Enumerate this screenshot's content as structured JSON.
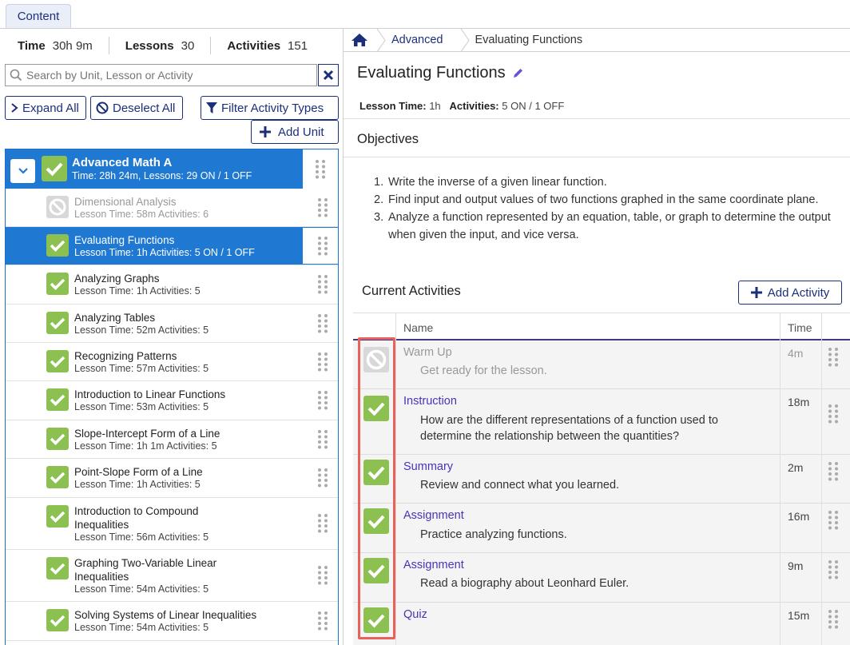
{
  "top_tab": {
    "label": "Content"
  },
  "stats": [
    {
      "key": "Time",
      "value": "30h 9m"
    },
    {
      "key": "Lessons",
      "value": "30"
    },
    {
      "key": "Activities",
      "value": "151"
    }
  ],
  "search": {
    "placeholder": "Search by Unit, Lesson or Activity"
  },
  "buttons": {
    "expand_all": "Expand All",
    "deselect_all": "Deselect All",
    "filter_activity_types": "Filter Activity Types",
    "add_unit": "Add Unit"
  },
  "unit": {
    "title": "Advanced Math A",
    "subtitle": "Time: 28h 24m, Lessons: 29 ON / 1 OFF"
  },
  "lessons": [
    {
      "title": "Dimensional Analysis",
      "sub": "Lesson Time: 58m   Activities: 6",
      "state": "off"
    },
    {
      "title": "Evaluating Functions",
      "sub": "Lesson Time: 1h   Activities: 5 ON / 1 OFF",
      "state": "selected"
    },
    {
      "title": "Analyzing Graphs",
      "sub": "Lesson Time: 1h   Activities: 5",
      "state": "on"
    },
    {
      "title": "Analyzing Tables",
      "sub": "Lesson Time: 52m   Activities: 5",
      "state": "on"
    },
    {
      "title": "Recognizing Patterns",
      "sub": "Lesson Time: 57m   Activities: 5",
      "state": "on"
    },
    {
      "title": "Introduction to Linear Functions",
      "sub": "Lesson Time: 53m   Activities: 5",
      "state": "on"
    },
    {
      "title": "Slope-Intercept Form of a Line",
      "sub": "Lesson Time: 1h 1m   Activities: 5",
      "state": "on"
    },
    {
      "title": "Point-Slope Form of a Line",
      "sub": "Lesson Time: 1h   Activities: 5",
      "state": "on"
    },
    {
      "title": "Introduction to Compound Inequalities",
      "sub": "Lesson Time: 56m   Activities: 5",
      "state": "on"
    },
    {
      "title": "Graphing Two-Variable Linear Inequalities",
      "sub": "Lesson Time: 54m   Activities: 5",
      "state": "on"
    },
    {
      "title": "Solving Systems of Linear Inequalities",
      "sub": "Lesson Time: 54m   Activities: 5",
      "state": "on"
    }
  ],
  "breadcrumb": {
    "items": [
      "Advanced",
      "Evaluating Functions"
    ]
  },
  "detail": {
    "title": "Evaluating Functions",
    "meta_time_label": "Lesson Time:",
    "meta_time_value": "1h",
    "meta_act_label": "Activities:",
    "meta_act_value": "5 ON / 1 OFF",
    "objectives_title": "Objectives",
    "objectives": [
      "Write the inverse of a given linear function.",
      "Find input and output values of two functions graphed in the same coordinate plane.",
      "Analyze a function represented by an equation, table, or graph to determine the output when given the input, and vice versa."
    ],
    "activities_title": "Current Activities",
    "add_activity": "Add Activity",
    "col_name": "Name",
    "col_time": "Time"
  },
  "activities": [
    {
      "name": "Warm Up",
      "desc": "Get ready for the lesson.",
      "time": "4m",
      "state": "off"
    },
    {
      "name": "Instruction",
      "desc": "How are the different representations of a function used to determine the relationship between the quantities?",
      "time": "18m",
      "state": "on"
    },
    {
      "name": "Summary",
      "desc": "Review and connect what you learned.",
      "time": "2m",
      "state": "on"
    },
    {
      "name": "Assignment",
      "desc": "Practice analyzing functions.",
      "time": "16m",
      "state": "on"
    },
    {
      "name": "Assignment",
      "desc": "Read a biography about Leonhard Euler.",
      "time": "9m",
      "state": "on"
    },
    {
      "name": "Quiz",
      "desc": "",
      "time": "15m",
      "state": "on"
    }
  ],
  "colors": {
    "accent": "#1c2f7a",
    "selected": "#1f78d1",
    "check_green": "#8cc152",
    "activity_link": "#4a33b6",
    "highlight": "#e8615a"
  }
}
